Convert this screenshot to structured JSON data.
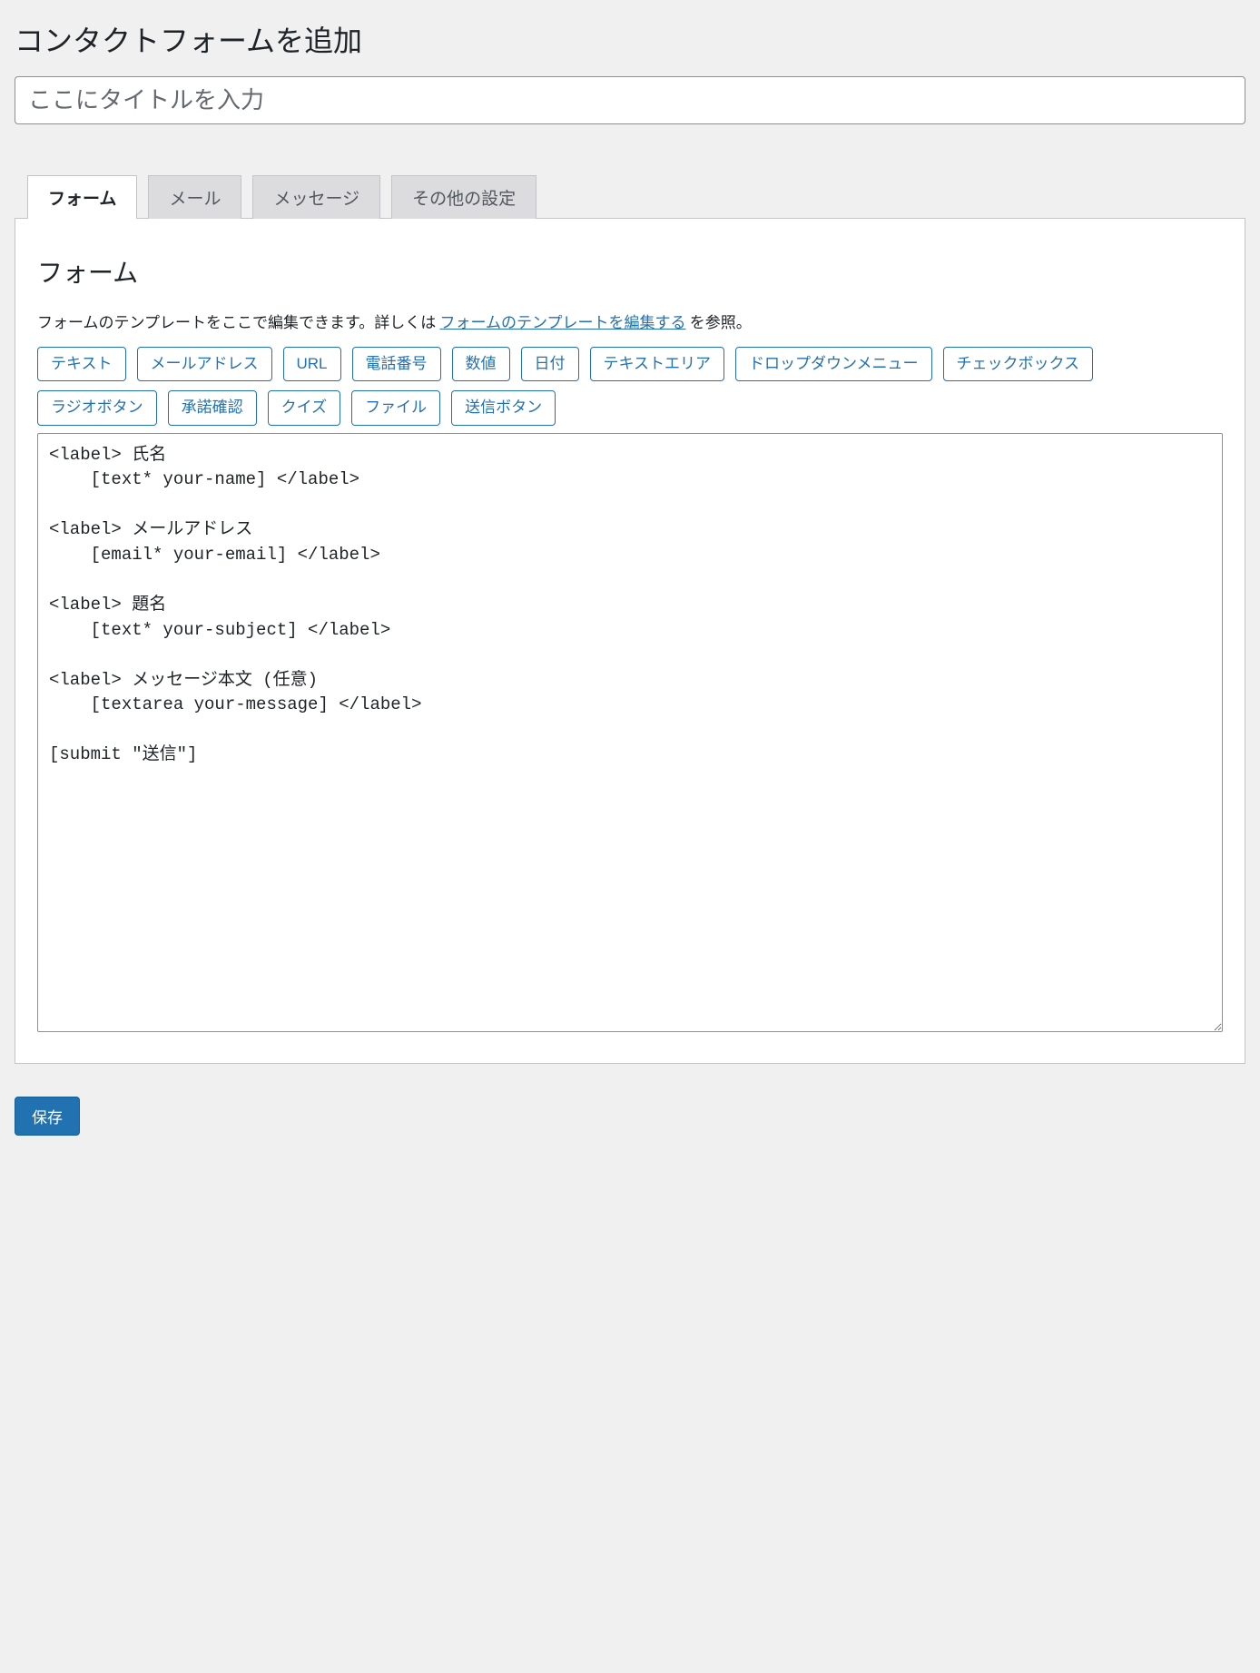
{
  "page": {
    "heading": "コンタクトフォームを追加",
    "title_placeholder": "ここにタイトルを入力",
    "title_value": ""
  },
  "tabs": [
    {
      "label": "フォーム",
      "active": true
    },
    {
      "label": "メール",
      "active": false
    },
    {
      "label": "メッセージ",
      "active": false
    },
    {
      "label": "その他の設定",
      "active": false
    }
  ],
  "panel": {
    "heading": "フォーム",
    "helper_prefix": "フォームのテンプレートをここで編集できます。詳しくは",
    "helper_link_text": "フォームのテンプレートを編集する",
    "helper_suffix": "を参照。"
  },
  "tag_buttons": [
    "テキスト",
    "メールアドレス",
    "URL",
    "電話番号",
    "数値",
    "日付",
    "テキストエリア",
    "ドロップダウンメニュー",
    "チェックボックス",
    "ラジオボタン",
    "承諾確認",
    "クイズ",
    "ファイル",
    "送信ボタン"
  ],
  "form_template": "<label> 氏名\n    [text* your-name] </label>\n\n<label> メールアドレス\n    [email* your-email] </label>\n\n<label> 題名\n    [text* your-subject] </label>\n\n<label> メッセージ本文 (任意)\n    [textarea your-message] </label>\n\n[submit \"送信\"]",
  "save_label": "保存"
}
